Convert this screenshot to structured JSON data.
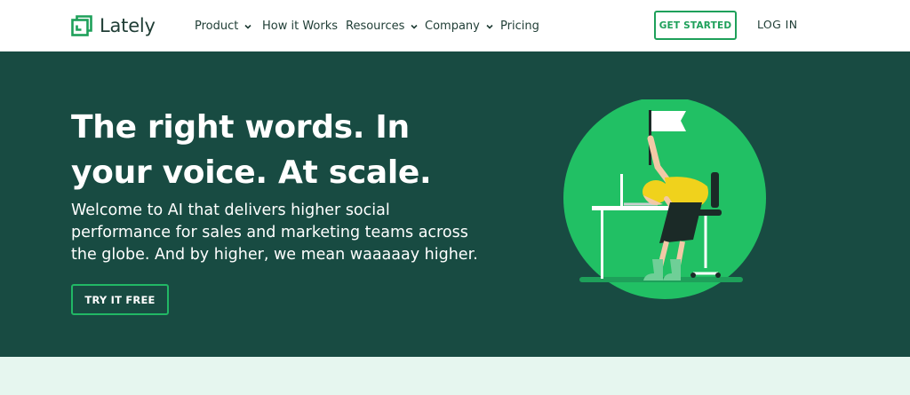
{
  "brand": {
    "name": "Lately",
    "accent": "#1ea05a",
    "dark": "#184b42"
  },
  "nav": {
    "items": [
      {
        "label": "Product",
        "has_dropdown": true
      },
      {
        "label": "How it Works",
        "has_dropdown": false
      },
      {
        "label": "Resources",
        "has_dropdown": true
      },
      {
        "label": "Company",
        "has_dropdown": true
      },
      {
        "label": "Pricing",
        "has_dropdown": false
      }
    ],
    "get_started": "GET STARTED",
    "login": "LOG IN"
  },
  "hero": {
    "headline": "The right words. In your voice. At scale.",
    "subheadline": "Welcome to AI that delivers higher social performance for sales and marketing teams across the globe. And by higher, we mean waaaaay higher.",
    "cta": "TRY IT FREE",
    "illustration": "person-slumped-at-desk-waving-white-flag"
  }
}
